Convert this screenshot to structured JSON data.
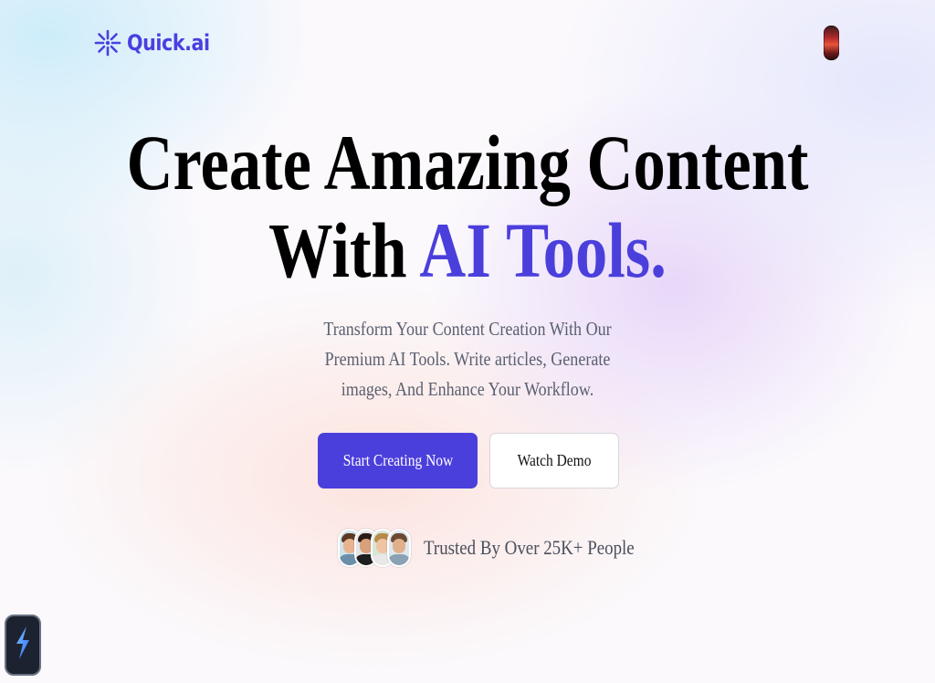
{
  "brand": {
    "name": "Quick.ai",
    "logo_icon": "sparkle-icon",
    "accent_color": "#4b3fdc"
  },
  "header": {
    "profile_icon": "user-avatar"
  },
  "hero": {
    "title_line1": "Create Amazing Content",
    "title_line2_prefix": "With ",
    "title_line2_accent": "AI Tools.",
    "subtitle": "Transform Your Content Creation With Our Premium AI Tools. Write articles, Generate images, And Enhance Your Workflow."
  },
  "cta": {
    "primary_label": "Start Creating Now",
    "secondary_label": "Watch Demo"
  },
  "social_proof": {
    "avatar_count": 4,
    "text": "Trusted By Over 25K+ People"
  },
  "floating_widget": {
    "icon": "lightning-icon"
  }
}
